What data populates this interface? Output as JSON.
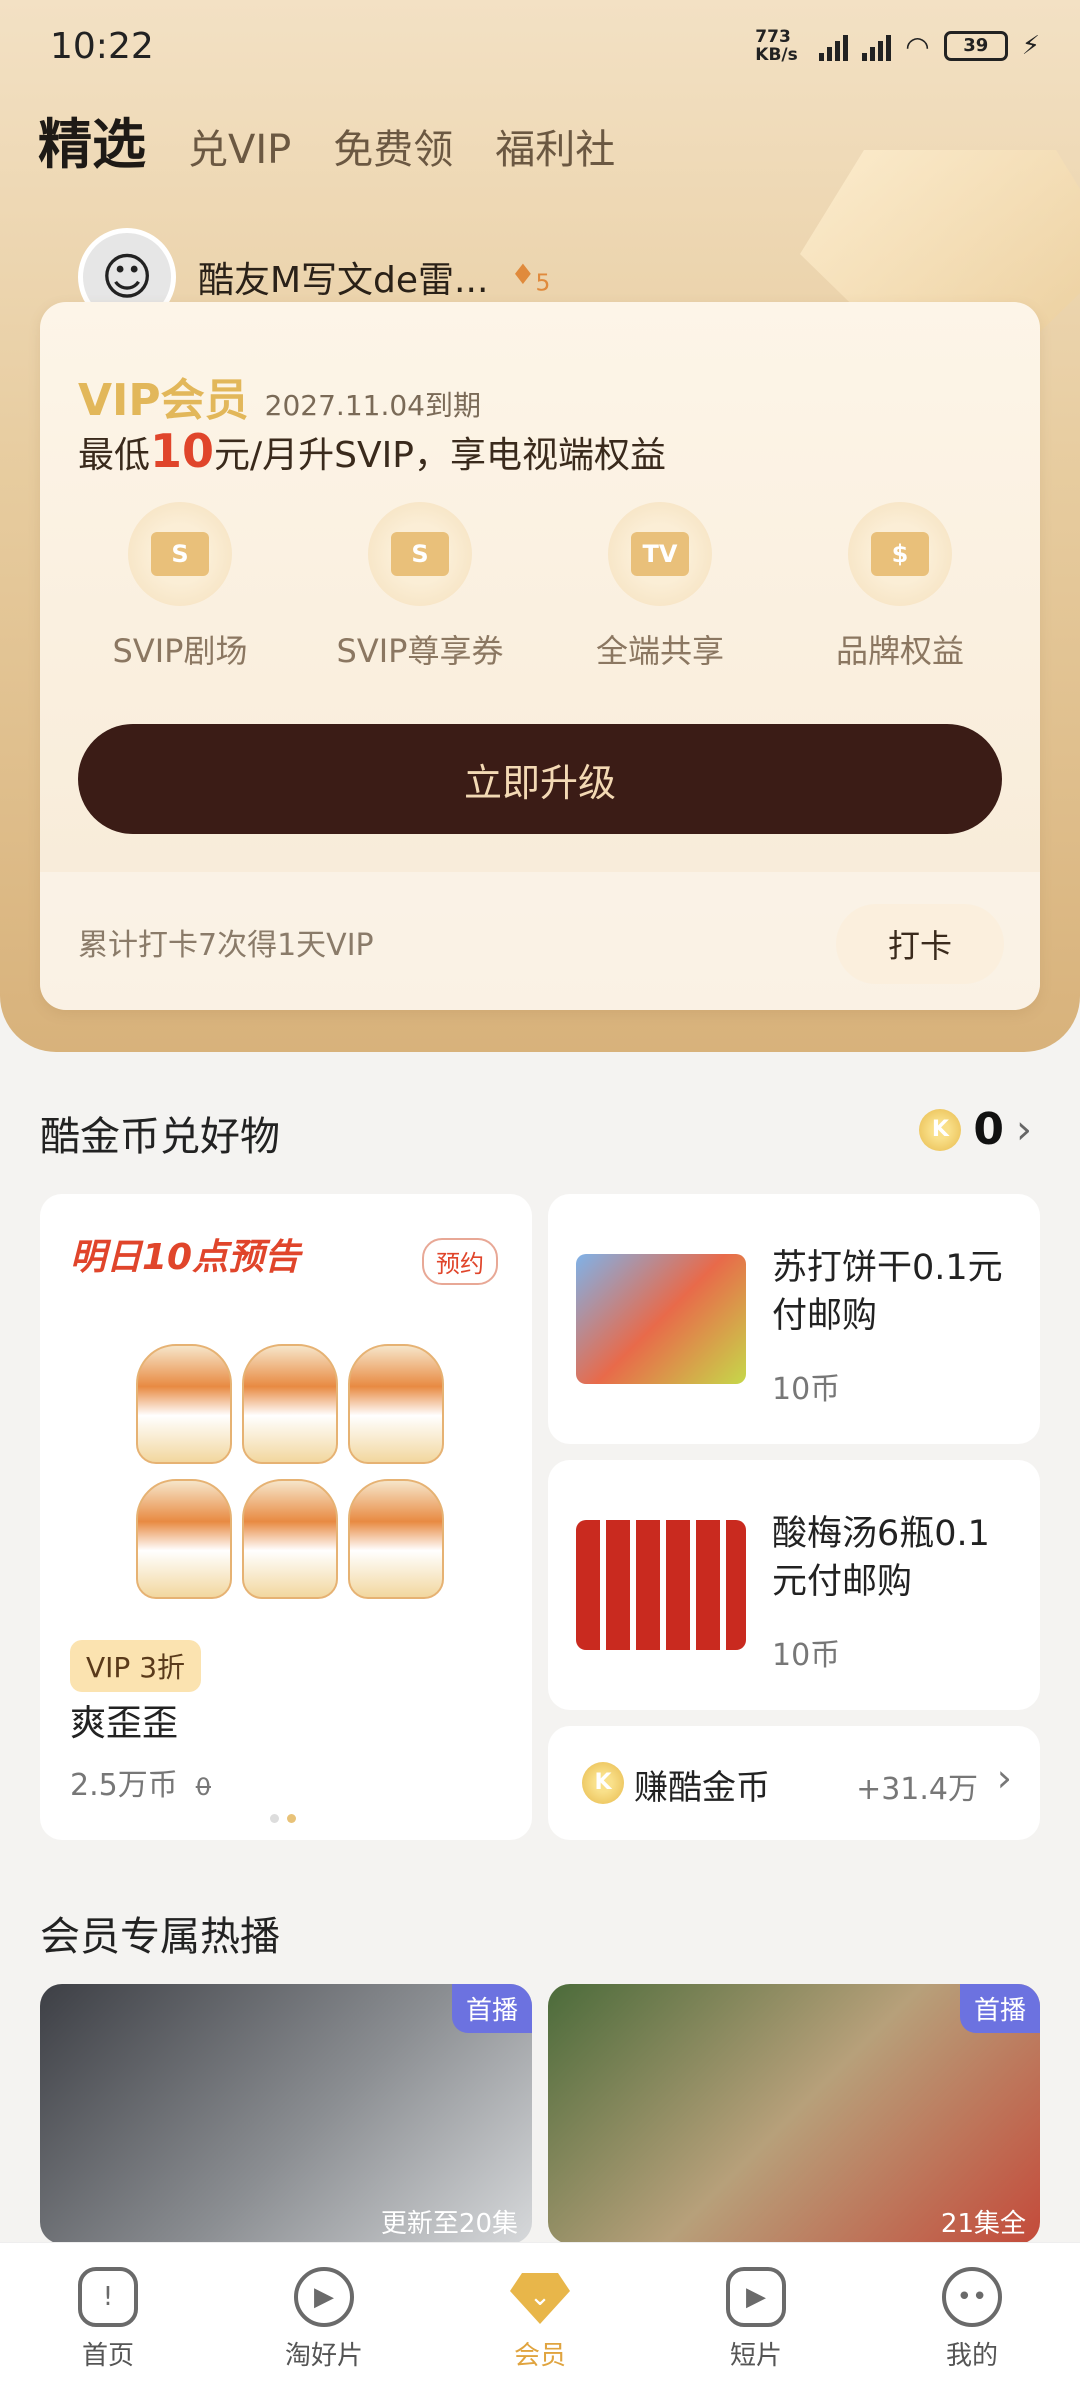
{
  "status": {
    "time": "10:22",
    "net_speed": "773 KB/s",
    "battery": "39"
  },
  "nav": {
    "tabs": [
      "精选",
      "兑VIP",
      "免费领",
      "福利社"
    ]
  },
  "user": {
    "name": "酷友M写文de雷...",
    "level": "5"
  },
  "vip": {
    "label": "VIP会员",
    "expire": "2027.11.04到期",
    "promo_pre": "最低",
    "promo_price": "10",
    "promo_post": "元/月升SVIP，享电视端权益"
  },
  "benefits": [
    {
      "label": "SVIP剧场",
      "icon": "theater-icon"
    },
    {
      "label": "SVIP尊享券",
      "icon": "coupon-icon"
    },
    {
      "label": "全端共享",
      "icon": "tv-icon"
    },
    {
      "label": "品牌权益",
      "icon": "gift-icon"
    }
  ],
  "upgrade_label": "立即升级",
  "checkin": {
    "text": "累计打卡7次得1天VIP",
    "button": "打卡"
  },
  "mall": {
    "title": "酷金币兑好物",
    "balance": "0"
  },
  "feature": {
    "preview": "明日10点预告",
    "reserve": "预约",
    "tag": "VIP 3折",
    "name": "爽歪歪",
    "price": "2.5万币",
    "orig": "0"
  },
  "items": [
    {
      "title": "苏打饼干0.1元付邮购",
      "price": "10币"
    },
    {
      "title": "酸梅汤6瓶0.1元付邮购",
      "price": "10币"
    }
  ],
  "earn": {
    "label": "赚酷金币",
    "value": "+31.4万"
  },
  "hot": {
    "title": "会员专属热播",
    "videos": [
      {
        "tag": "首播",
        "update": "更新至20集"
      },
      {
        "tag": "首播",
        "update": "21集全"
      }
    ]
  },
  "tabbar": [
    {
      "label": "首页"
    },
    {
      "label": "淘好片"
    },
    {
      "label": "会员"
    },
    {
      "label": "短片"
    },
    {
      "label": "我的"
    }
  ]
}
